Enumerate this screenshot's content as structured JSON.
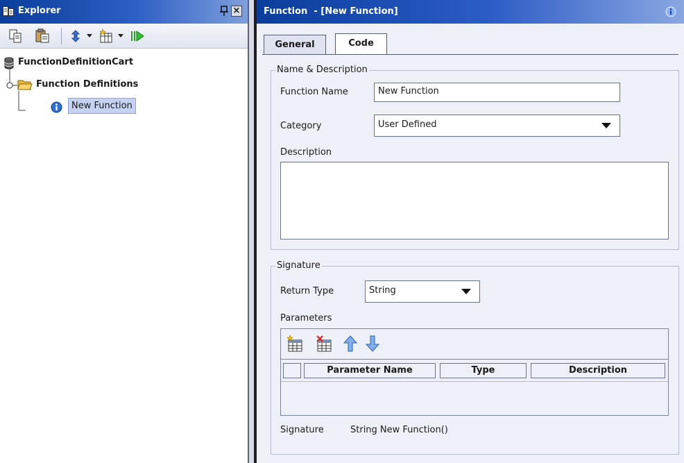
{
  "explorer": {
    "title": "Explorer",
    "tree": {
      "root": "FunctionDefinitionCart",
      "folder": "Function Definitions",
      "leaf": "New Function"
    }
  },
  "editor": {
    "title": "Function  - [New Function]",
    "tabs": {
      "general": "General",
      "code": "Code"
    },
    "name_group": {
      "legend": "Name & Description",
      "function_name_label": "Function Name",
      "function_name_value": "New Function",
      "category_label": "Category",
      "category_value": "User Defined",
      "description_label": "Description",
      "description_value": ""
    },
    "signature_group": {
      "legend": "Signature",
      "return_type_label": "Return Type",
      "return_type_value": "String",
      "parameters_label": "Parameters",
      "columns": [
        "Parameter Name",
        "Type",
        "Description"
      ],
      "signature_label": "Signature",
      "signature_value": "String New Function()"
    }
  },
  "colors": {
    "titlebar_start": "#0a3d9c",
    "titlebar_end": "#8aa7e2",
    "panel_bg": "#eef0f8",
    "selection_bg": "#c5d2f2"
  }
}
